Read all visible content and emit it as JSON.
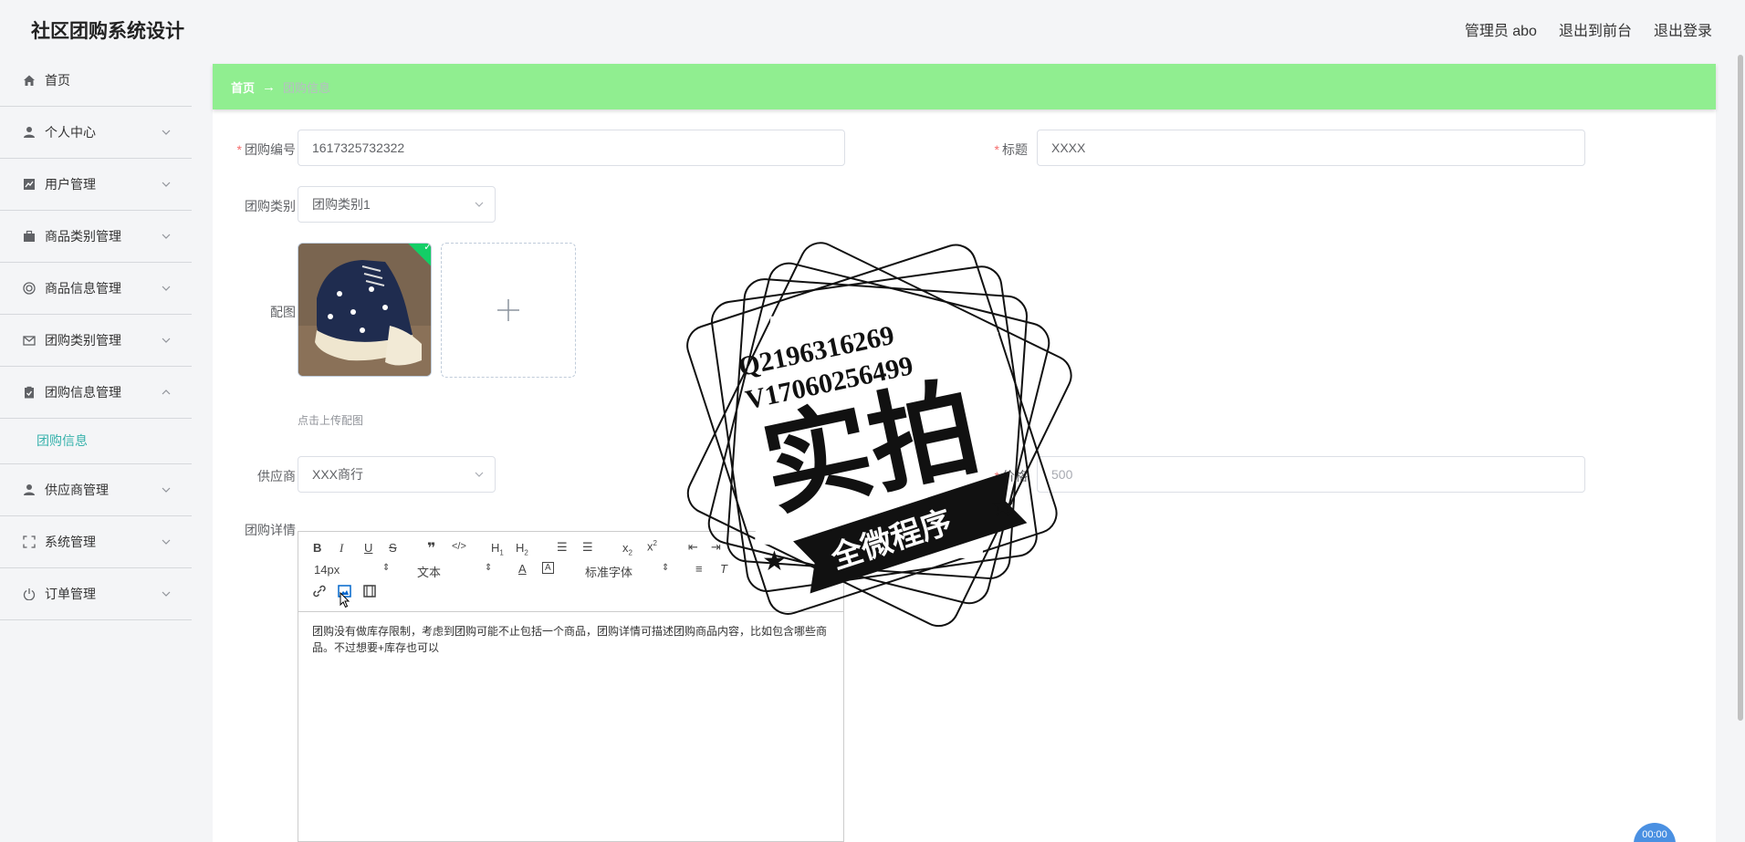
{
  "header": {
    "brand": "社区团购系统设计",
    "admin": "管理员 abo",
    "to_front": "退出到前台",
    "logout": "退出登录"
  },
  "sidebar": {
    "items": [
      {
        "label": "首页",
        "icon": "home-icon"
      },
      {
        "label": "个人中心",
        "icon": "user-icon"
      },
      {
        "label": "用户管理",
        "icon": "chart-icon"
      },
      {
        "label": "商品类别管理",
        "icon": "briefcase-icon"
      },
      {
        "label": "商品信息管理",
        "icon": "circle-icon"
      },
      {
        "label": "团购类别管理",
        "icon": "mail-icon"
      },
      {
        "label": "团购信息管理",
        "icon": "clipboard-icon"
      },
      {
        "label": "供应商管理",
        "icon": "user-icon"
      },
      {
        "label": "系统管理",
        "icon": "fullscreen-icon"
      },
      {
        "label": "订单管理",
        "icon": "power-icon"
      }
    ],
    "sub_item": "团购信息"
  },
  "breadcrumb": {
    "home": "首页",
    "arrow": "→",
    "current": "团购信息"
  },
  "form": {
    "code_label": "团购编号",
    "code_value": "1617325732322",
    "title_label": "标题",
    "title_value": "XXXX",
    "category_label": "团购类别",
    "category_value": "团购类别1",
    "image_label": "配图",
    "upload_tip": "点击上传配图",
    "supplier_label": "供应商",
    "supplier_value": "XXX商行",
    "price_label": "价格",
    "price_value": "500",
    "detail_label": "团购详情"
  },
  "editor": {
    "font_size": "14px",
    "paragraph": "文本",
    "font_family": "标准字体",
    "content": "团购没有做库存限制，考虑到团购可能不止包括一个商品，团购详情可描述团购商品内容，比如包含哪些商品。不过想要+库存也可以"
  },
  "stamp": {
    "line1": "Q2196316269",
    "line2": "V17060256499",
    "big": "实拍",
    "banner": "全微程序"
  },
  "float_button": "00:00",
  "colors": {
    "breadcrumb_bg": "#90ee90",
    "accent": "#38b2ac",
    "required": "#f56c6c"
  }
}
